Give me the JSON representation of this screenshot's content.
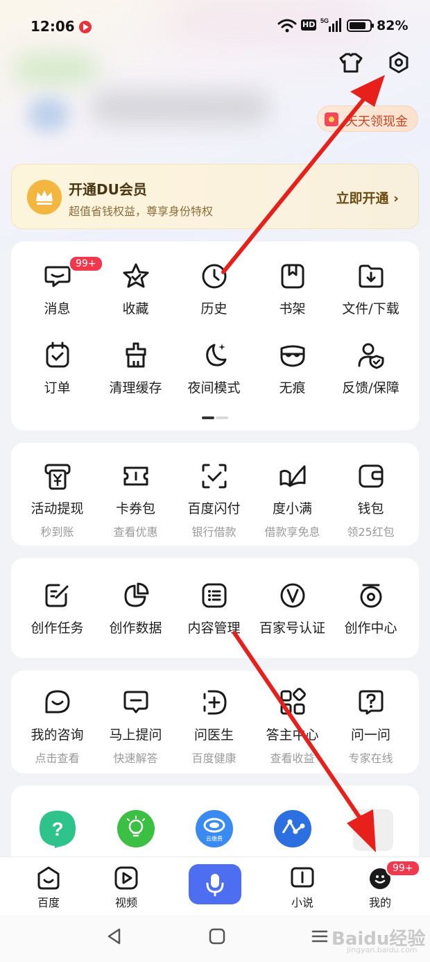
{
  "status_bar": {
    "time": "12:06",
    "network": "5G",
    "hd": "HD",
    "battery": "82%",
    "battery_level": 0.82
  },
  "header": {
    "cash_chip": "天天领现金"
  },
  "vip": {
    "title": "开通DU会员",
    "subtitle": "超值省钱权益，尊享身份特权",
    "cta": "立即开通 ›"
  },
  "tools": {
    "row1": [
      {
        "label": "消息",
        "badge": "99+"
      },
      {
        "label": "收藏"
      },
      {
        "label": "历史"
      },
      {
        "label": "书架"
      },
      {
        "label": "文件/下载"
      }
    ],
    "row2": [
      {
        "label": "订单"
      },
      {
        "label": "清理缓存"
      },
      {
        "label": "夜间模式"
      },
      {
        "label": "无痕"
      },
      {
        "label": "反馈/保障"
      }
    ]
  },
  "finance": [
    {
      "label": "活动提现",
      "sub": "秒到账"
    },
    {
      "label": "卡券包",
      "sub": "查看优惠"
    },
    {
      "label": "百度闪付",
      "sub": "银行借款"
    },
    {
      "label": "度小满",
      "sub": "借款享免息"
    },
    {
      "label": "钱包",
      "sub": "领25红包"
    }
  ],
  "creator": [
    {
      "label": "创作任务"
    },
    {
      "label": "创作数据"
    },
    {
      "label": "内容管理"
    },
    {
      "label": "百家号认证"
    },
    {
      "label": "创作中心"
    }
  ],
  "consult": [
    {
      "label": "我的咨询",
      "sub": "点击查看"
    },
    {
      "label": "马上提问",
      "sub": "快速解答"
    },
    {
      "label": "问医生",
      "sub": "百度健康"
    },
    {
      "label": "答主中心",
      "sub": "查看收益"
    },
    {
      "label": "问一问",
      "sub": "专家在线"
    }
  ],
  "apps": {
    "cloud_label": "云缴费"
  },
  "tabbar": {
    "home": "百度",
    "video": "视频",
    "novel": "小说",
    "mine": "我的",
    "mine_badge": "99+"
  },
  "watermark": {
    "text": "Baidu经验",
    "sub": "jingyan.baidu.com"
  }
}
